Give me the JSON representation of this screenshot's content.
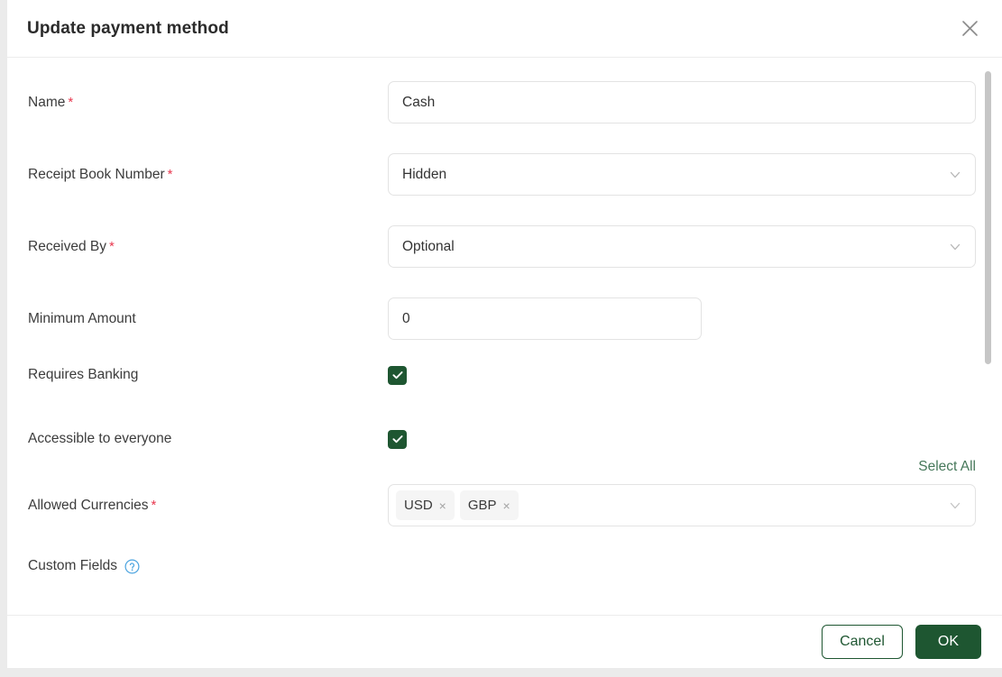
{
  "dialog": {
    "title": "Update payment method",
    "close_icon": "close-icon"
  },
  "form": {
    "fields": [
      {
        "label": "Name",
        "required": true,
        "type": "text",
        "value": "Cash"
      },
      {
        "label": "Receipt Book Number",
        "required": true,
        "type": "select",
        "value": "Hidden"
      },
      {
        "label": "Received By",
        "required": true,
        "type": "select",
        "value": "Optional"
      },
      {
        "label": "Minimum Amount",
        "required": false,
        "type": "number",
        "value": "0"
      },
      {
        "label": "Requires Banking",
        "required": false,
        "type": "checkbox",
        "checked": true
      },
      {
        "label": "Accessible to everyone",
        "required": false,
        "type": "checkbox",
        "checked": true
      },
      {
        "label": "Allowed Currencies",
        "required": true,
        "type": "multiselect",
        "tags": [
          "USD",
          "GBP"
        ],
        "tag_remove_glyph": "×"
      },
      {
        "label": "Custom Fields",
        "required": false,
        "type": "section",
        "help_icon": "help-circle-icon"
      }
    ],
    "select_all_label": "Select All",
    "chevron_icon": "chevron-down-icon"
  },
  "footer": {
    "cancel_label": "Cancel",
    "ok_label": "OK"
  },
  "colors": {
    "primary_green": "#1e5631",
    "link_green": "#46785a",
    "required_red": "#e8384f",
    "backdrop": "#ebebeb",
    "border": "#e3e3e3",
    "help_blue": "#4aa3df"
  },
  "scrollbar": {
    "orientation": "vertical"
  }
}
